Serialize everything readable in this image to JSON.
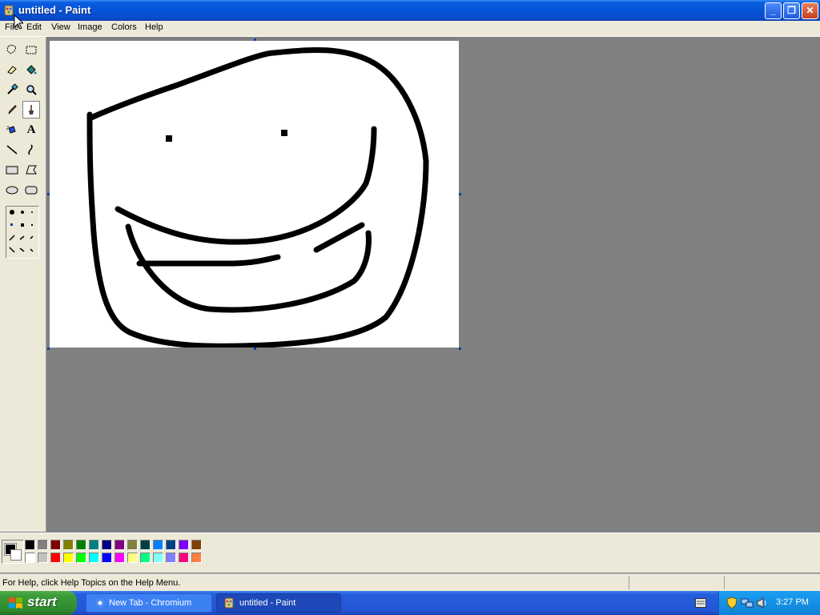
{
  "window": {
    "title": "untitled - Paint"
  },
  "menu": {
    "items": [
      "File",
      "Edit",
      "View",
      "Image",
      "Colors",
      "Help"
    ]
  },
  "tools": [
    {
      "name": "free-form-select-icon"
    },
    {
      "name": "select-icon"
    },
    {
      "name": "eraser-icon"
    },
    {
      "name": "fill-bucket-icon"
    },
    {
      "name": "pick-color-icon"
    },
    {
      "name": "magnifier-icon"
    },
    {
      "name": "pencil-icon"
    },
    {
      "name": "brush-icon"
    },
    {
      "name": "airbrush-icon"
    },
    {
      "name": "text-icon"
    },
    {
      "name": "line-icon"
    },
    {
      "name": "curve-icon"
    },
    {
      "name": "rectangle-icon"
    },
    {
      "name": "polygon-icon"
    },
    {
      "name": "ellipse-icon"
    },
    {
      "name": "rounded-rectangle-icon"
    }
  ],
  "selected_tool": "brush-icon",
  "palette": {
    "foreground": "#000000",
    "background": "#ffffff",
    "top_row": [
      "#000000",
      "#808080",
      "#800000",
      "#808000",
      "#008000",
      "#008080",
      "#000080",
      "#800080",
      "#808040",
      "#004040",
      "#0080ff",
      "#004080",
      "#8000ff",
      "#804000"
    ],
    "bottom_row": [
      "#ffffff",
      "#c0c0c0",
      "#ff0000",
      "#ffff00",
      "#00ff00",
      "#00ffff",
      "#0000ff",
      "#ff00ff",
      "#ffff80",
      "#00ff80",
      "#80ffff",
      "#8080ff",
      "#ff0080",
      "#ff8040"
    ]
  },
  "status": {
    "help_text": "For Help, click Help Topics on the Help Menu."
  },
  "taskbar": {
    "start_label": "start",
    "tasks": [
      {
        "label": "New Tab - Chromium",
        "active": false
      },
      {
        "label": "untitled - Paint",
        "active": true
      }
    ],
    "clock": "3:27 PM"
  }
}
